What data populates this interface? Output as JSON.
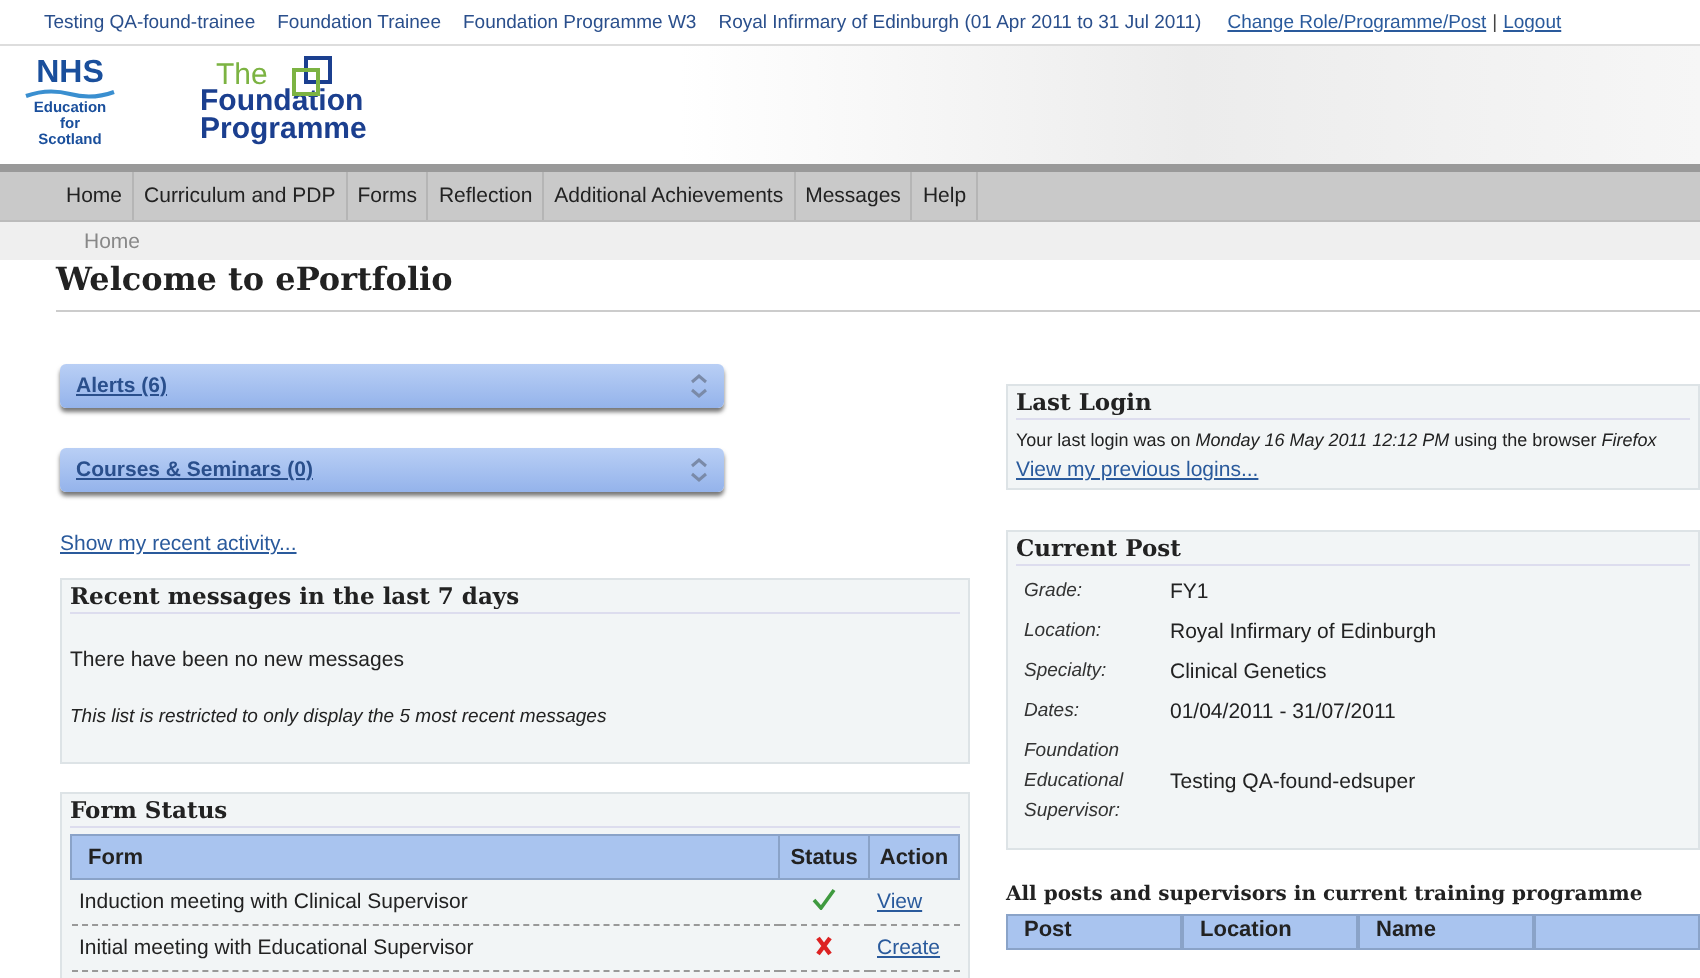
{
  "top_bar": {
    "items": [
      "Testing QA-found-trainee",
      "Foundation Trainee",
      "Foundation Programme W3",
      "Royal Infirmary of Edinburgh (01 Apr 2011 to 31 Jul 2011)"
    ],
    "links": [
      "Change Role/Programme/Post",
      "Logout"
    ],
    "separator": "|"
  },
  "header": {
    "nhs_logo": {
      "mark": "NHS",
      "lines": [
        "Education",
        "for",
        "Scotland"
      ]
    },
    "programme_logo": {
      "line1": "The",
      "line2": "Foundation",
      "line3": "Programme"
    }
  },
  "nav": [
    "Home",
    "Curriculum and PDP",
    "Forms",
    "Reflection",
    "Additional Achievements",
    "Messages",
    "Help"
  ],
  "breadcrumb": "Home",
  "page_title": "Welcome to ePortfolio",
  "accordions": [
    {
      "label": "Alerts (6)"
    },
    {
      "label": "Courses & Seminars (0)"
    }
  ],
  "recent_activity_link": "Show my recent activity...",
  "recent_messages": {
    "title": "Recent messages in the last 7 days",
    "message": "There have been no new messages",
    "note": "This list is restricted to only display the 5 most recent messages"
  },
  "form_status": {
    "title": "Form Status",
    "columns": [
      "Form",
      "Status",
      "Action"
    ],
    "rows": [
      {
        "form": "Induction meeting with Clinical Supervisor",
        "completed": true,
        "action": "View"
      },
      {
        "form": "Initial meeting with Educational Supervisor",
        "completed": false,
        "action": "Create"
      }
    ]
  },
  "last_login": {
    "title": "Last Login",
    "text": "Your last login was on *Monday 16 May 2011 12:12 PM* using the browser *Firefox*",
    "link": "View my previous logins..."
  },
  "current_post": {
    "title": "Current Post",
    "fields": [
      {
        "label": "Grade:",
        "value": "FY1"
      },
      {
        "label": "Location:",
        "value": "Royal Infirmary of Edinburgh"
      },
      {
        "label": "Specialty:",
        "value": "Clinical Genetics"
      },
      {
        "label": "Dates:",
        "value": "01/04/2011 - 31/07/2011"
      },
      {
        "label": "Foundation Educational Supervisor:",
        "value": "Testing QA-found-edsuper"
      }
    ]
  },
  "all_posts": {
    "title": "All posts and supervisors in current training programme",
    "columns": [
      "Post",
      "Location",
      "Name"
    ]
  }
}
